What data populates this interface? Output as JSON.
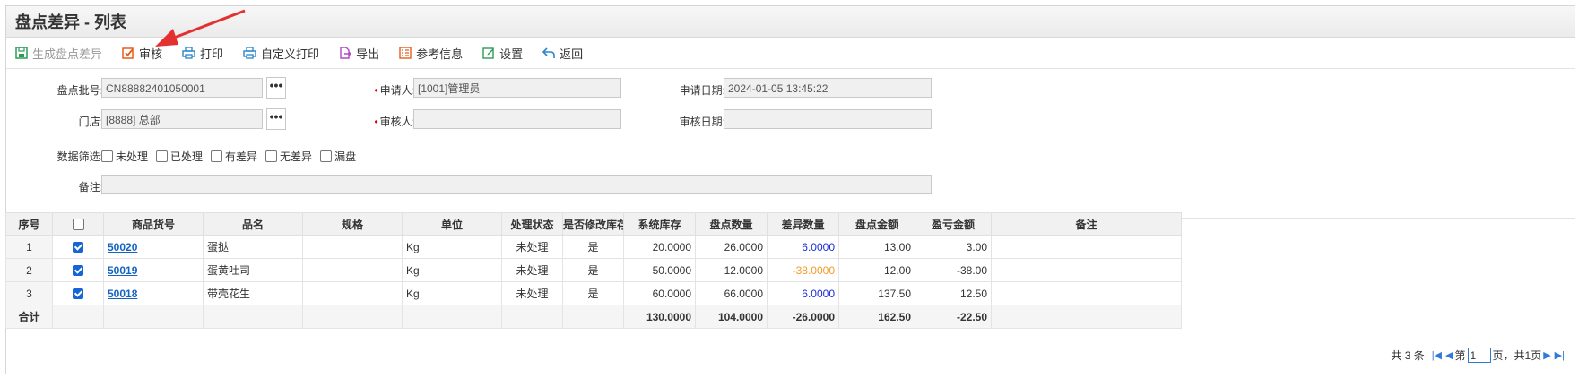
{
  "page": {
    "title": "盘点差异 - 列表"
  },
  "toolbar": [
    {
      "label": "生成盘点差异",
      "icon": "save-icon",
      "color": "#2a9d56",
      "disabled": true
    },
    {
      "label": "审核",
      "icon": "check-square-icon",
      "color": "#e85c1c",
      "disabled": false
    },
    {
      "label": "打印",
      "icon": "print-icon",
      "color": "#2a86c9",
      "disabled": false
    },
    {
      "label": "自定义打印",
      "icon": "print-icon",
      "color": "#2a86c9",
      "disabled": false
    },
    {
      "label": "导出",
      "icon": "export-icon",
      "color": "#b04ac6",
      "disabled": false
    },
    {
      "label": "参考信息",
      "icon": "list-icon",
      "color": "#e85c1c",
      "disabled": false
    },
    {
      "label": "设置",
      "icon": "edit-icon",
      "color": "#2a9d56",
      "disabled": false
    },
    {
      "label": "返回",
      "icon": "back-icon",
      "color": "#2a86c9",
      "disabled": false
    }
  ],
  "form": {
    "batch_label": "盘点批号:",
    "batch_value": "CN88882401050001",
    "store_label": "门店:",
    "store_value": "[8888] 总部",
    "applicant_label": "申请人:",
    "applicant_value": "[1001]管理员",
    "auditor_label": "审核人:",
    "auditor_value": "",
    "apply_date_label": "申请日期:",
    "apply_date_value": "2024-01-05 13:45:22",
    "audit_date_label": "审核日期:",
    "audit_date_value": "",
    "filter_label": "数据筛选:",
    "filters": [
      "未处理",
      "已处理",
      "有差异",
      "无差异",
      "漏盘"
    ],
    "remark_label": "备注:",
    "remark_value": "",
    "dots": "•••"
  },
  "table": {
    "headers": [
      "序号",
      "",
      "商品货号",
      "品名",
      "规格",
      "单位",
      "处理状态",
      "是否修改库存",
      "系统库存",
      "盘点数量",
      "差异数量",
      "盘点金额",
      "盈亏金额",
      "备注"
    ],
    "rows": [
      {
        "no": "1",
        "code": "50020",
        "name": "蛋挞",
        "spec": "",
        "unit": "Kg",
        "status": "未处理",
        "modified": "是",
        "sys_stock": "20.0000",
        "count_qty": "26.0000",
        "diff_qty": "6.0000",
        "amount": "13.00",
        "profit": "3.00",
        "remark": "",
        "diff_color": "blue"
      },
      {
        "no": "2",
        "code": "50019",
        "name": "蛋黄吐司",
        "spec": "",
        "unit": "Kg",
        "status": "未处理",
        "modified": "是",
        "sys_stock": "50.0000",
        "count_qty": "12.0000",
        "diff_qty": "-38.0000",
        "amount": "12.00",
        "profit": "-38.00",
        "remark": "",
        "diff_color": "orange"
      },
      {
        "no": "3",
        "code": "50018",
        "name": "带壳花生",
        "spec": "",
        "unit": "Kg",
        "status": "未处理",
        "modified": "是",
        "sys_stock": "60.0000",
        "count_qty": "66.0000",
        "diff_qty": "6.0000",
        "amount": "137.50",
        "profit": "12.50",
        "remark": "",
        "diff_color": "blue"
      }
    ],
    "total": {
      "label": "合计",
      "sys_stock": "130.0000",
      "count_qty": "104.0000",
      "diff_qty": "-26.0000",
      "amount": "162.50",
      "profit": "-22.50"
    }
  },
  "pager": {
    "total_text": "共 3 条",
    "page_prefix": "第",
    "page_value": "1",
    "page_suffix": "页，共1页"
  }
}
